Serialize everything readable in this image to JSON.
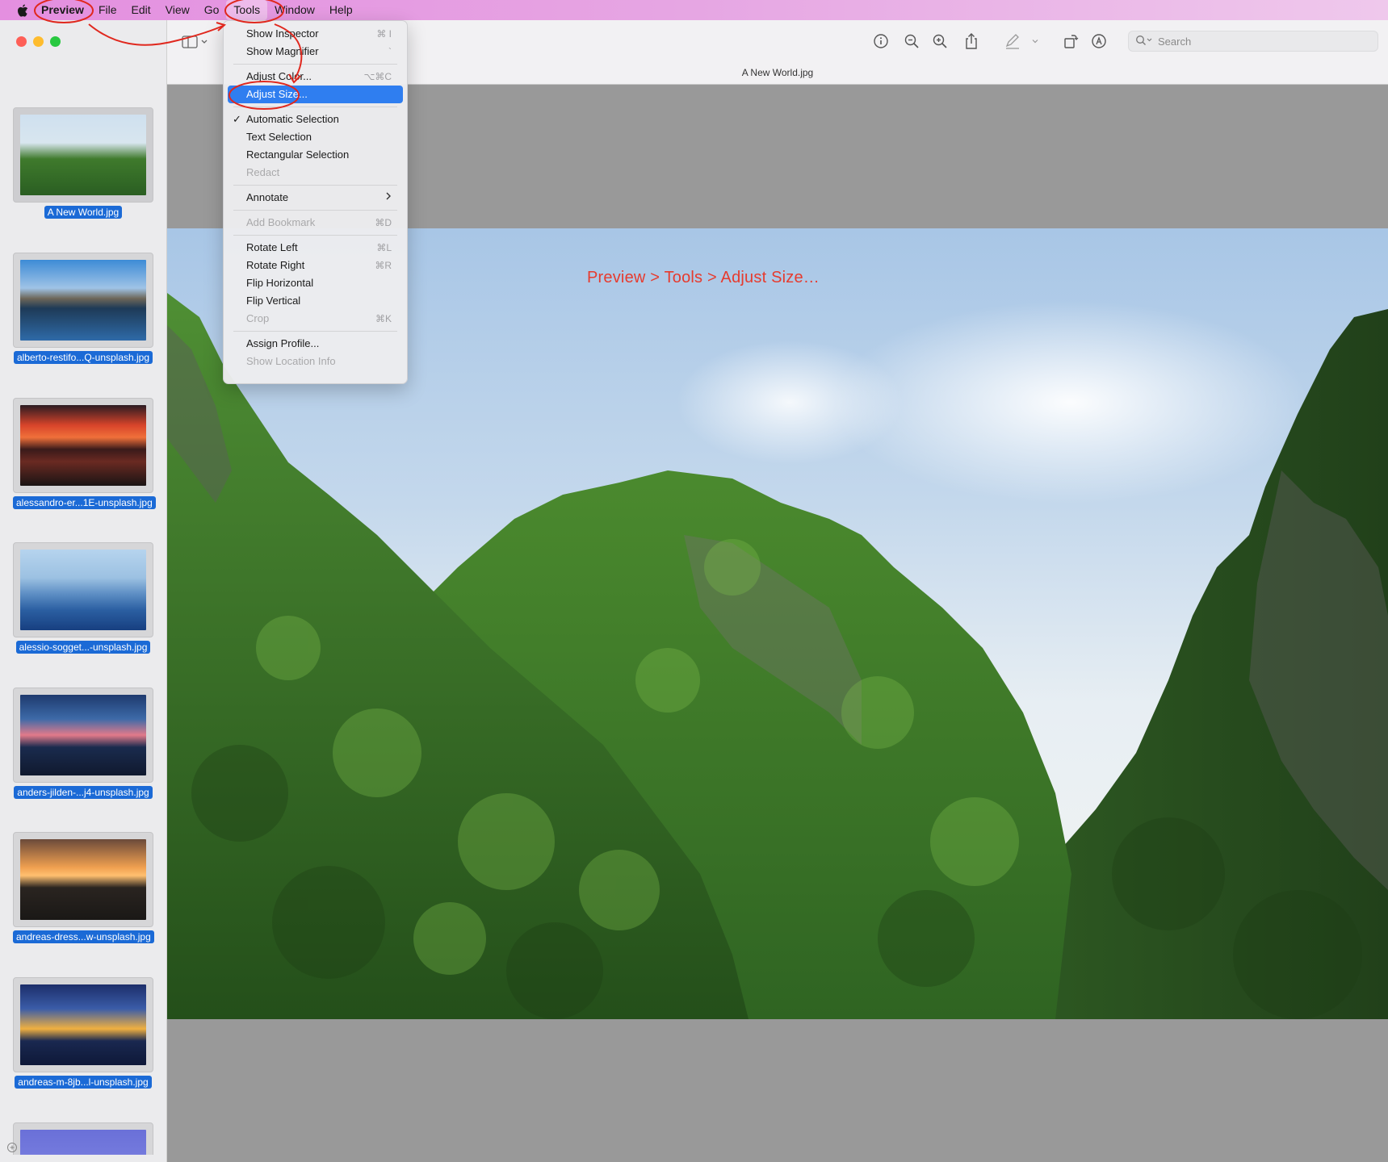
{
  "menubar": {
    "items": [
      "Preview",
      "File",
      "Edit",
      "View",
      "Go",
      "Tools",
      "Window",
      "Help"
    ]
  },
  "tools_menu": {
    "items": [
      {
        "label": "Show Inspector",
        "shortcut": "⌘ I",
        "disabled": false
      },
      {
        "label": "Show Magnifier",
        "shortcut": "`",
        "disabled": false
      },
      {
        "label": "Adjust Color...",
        "shortcut": "⌥⌘C",
        "disabled": false
      },
      {
        "label": "Adjust Size...",
        "shortcut": "",
        "disabled": false,
        "highlighted": true
      },
      {
        "label": "Automatic Selection",
        "checked": true,
        "disabled": false
      },
      {
        "label": "Text Selection",
        "disabled": false
      },
      {
        "label": "Rectangular Selection",
        "disabled": false
      },
      {
        "label": "Redact",
        "disabled": true
      },
      {
        "label": "Annotate",
        "submenu": true
      },
      {
        "label": "Add Bookmark",
        "shortcut": "⌘D",
        "disabled": true
      },
      {
        "label": "Rotate Left",
        "shortcut": "⌘L"
      },
      {
        "label": "Rotate Right",
        "shortcut": "⌘R"
      },
      {
        "label": "Flip Horizontal"
      },
      {
        "label": "Flip Vertical"
      },
      {
        "label": "Crop",
        "shortcut": "⌘K",
        "disabled": true
      },
      {
        "label": "Assign Profile..."
      },
      {
        "label": "Show Location Info",
        "disabled": true
      }
    ]
  },
  "toolbar": {
    "doc_title": "A New World.jpg",
    "search_placeholder": "Search",
    "icons": [
      "info-icon",
      "zoom-out-icon",
      "zoom-in-icon",
      "share-icon",
      "markup-pen-icon",
      "rotate-icon",
      "markup-icon"
    ]
  },
  "sidebar": {
    "thumbnails": [
      {
        "label": "A New World.jpg",
        "selected": true
      },
      {
        "label": "alberto-restifo...Q-unsplash.jpg"
      },
      {
        "label": "alessandro-er...1E-unsplash.jpg"
      },
      {
        "label": "alessio-sogget...-unsplash.jpg"
      },
      {
        "label": "anders-jilden-...j4-unsplash.jpg"
      },
      {
        "label": "andreas-dress...w-unsplash.jpg"
      },
      {
        "label": "andreas-m-8jb...l-unsplash.jpg"
      }
    ]
  },
  "annotation": "Preview > Tools > Adjust Size…",
  "colors": {
    "annotation_red": "#e63b2e",
    "menu_highlight": "#2f7ef0",
    "label_blue": "#1b6ad6"
  }
}
